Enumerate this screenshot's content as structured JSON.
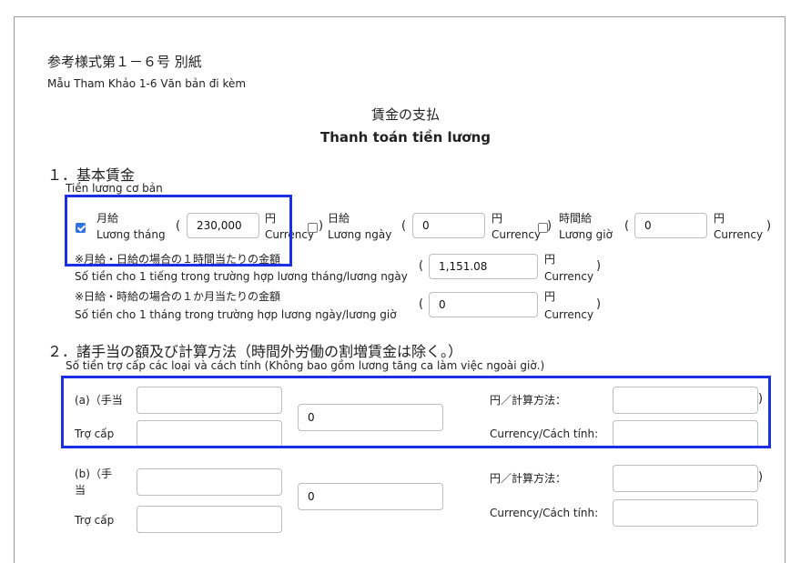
{
  "header": {
    "ref_title_jp": "参考様式第１－６号 別紙",
    "ref_title_vi": "Mẫu Tham Khảo 1-6 Văn bản đi kèm",
    "main_title_jp": "賃金の支払",
    "main_title_vi": "Thanh toán tiền lương"
  },
  "section1": {
    "heading_jp": "１．基本賃金",
    "heading_vi": "Tiền lương cơ bản",
    "monthly": {
      "label_jp": "月給",
      "label_vi": "Lương tháng",
      "value": "230,000",
      "unit_jp": "円",
      "unit_vi": "Currency",
      "checked": true
    },
    "daily": {
      "label_jp": "日給",
      "label_vi": "Lương ngày",
      "value": "0",
      "unit_jp": "円",
      "unit_vi": "Currency",
      "checked": false
    },
    "hourly": {
      "label_jp": "時間給",
      "label_vi": "Lương giờ",
      "value": "0",
      "unit_jp": "円",
      "unit_vi": "Currency",
      "checked": false
    },
    "per_hour": {
      "label_jp": "※月給・日給の場合の１時間当たりの金額",
      "label_vi": "Số tiền cho 1 tiếng trong trường hợp lương tháng/lương ngày",
      "value": "1,151.08",
      "unit_jp": "円",
      "unit_vi": "Currency"
    },
    "per_month": {
      "label_jp": "※日給・時給の場合の１か月当たりの金額",
      "label_vi": "Số tiền cho 1 tháng trong trường hợp lương ngày/lương giờ",
      "value": "0",
      "unit_jp": "円",
      "unit_vi": "Currency"
    }
  },
  "section2": {
    "heading_jp": "２．諸手当の額及び計算方法（時間外労働の割増賃金は除く。）",
    "heading_vi": "Số tiền trợ cấp các loại và cách tính (Không bao gồm lương tăng ca làm việc ngoài giờ.)",
    "rows": [
      {
        "label_jp": "(a)（手当",
        "label_vi": "Trợ cấp",
        "name_value": "",
        "amount_value": "0",
        "unit_jp": "円／計算方法：",
        "unit_vi": "Currency/Cách tính:",
        "method_value": ""
      },
      {
        "label_jp": "(b)（手",
        "label_jp2": "当",
        "label_vi": "Trợ cấp",
        "name_value": "",
        "amount_value": "0",
        "unit_jp": "円／計算方法：",
        "unit_vi": "Currency/Cách tính:",
        "method_value": ""
      }
    ]
  },
  "paren_open": "(",
  "paren_close": ")",
  "colors": {
    "highlight": "#1a2fe6",
    "checkbox": "#2f72e0"
  }
}
